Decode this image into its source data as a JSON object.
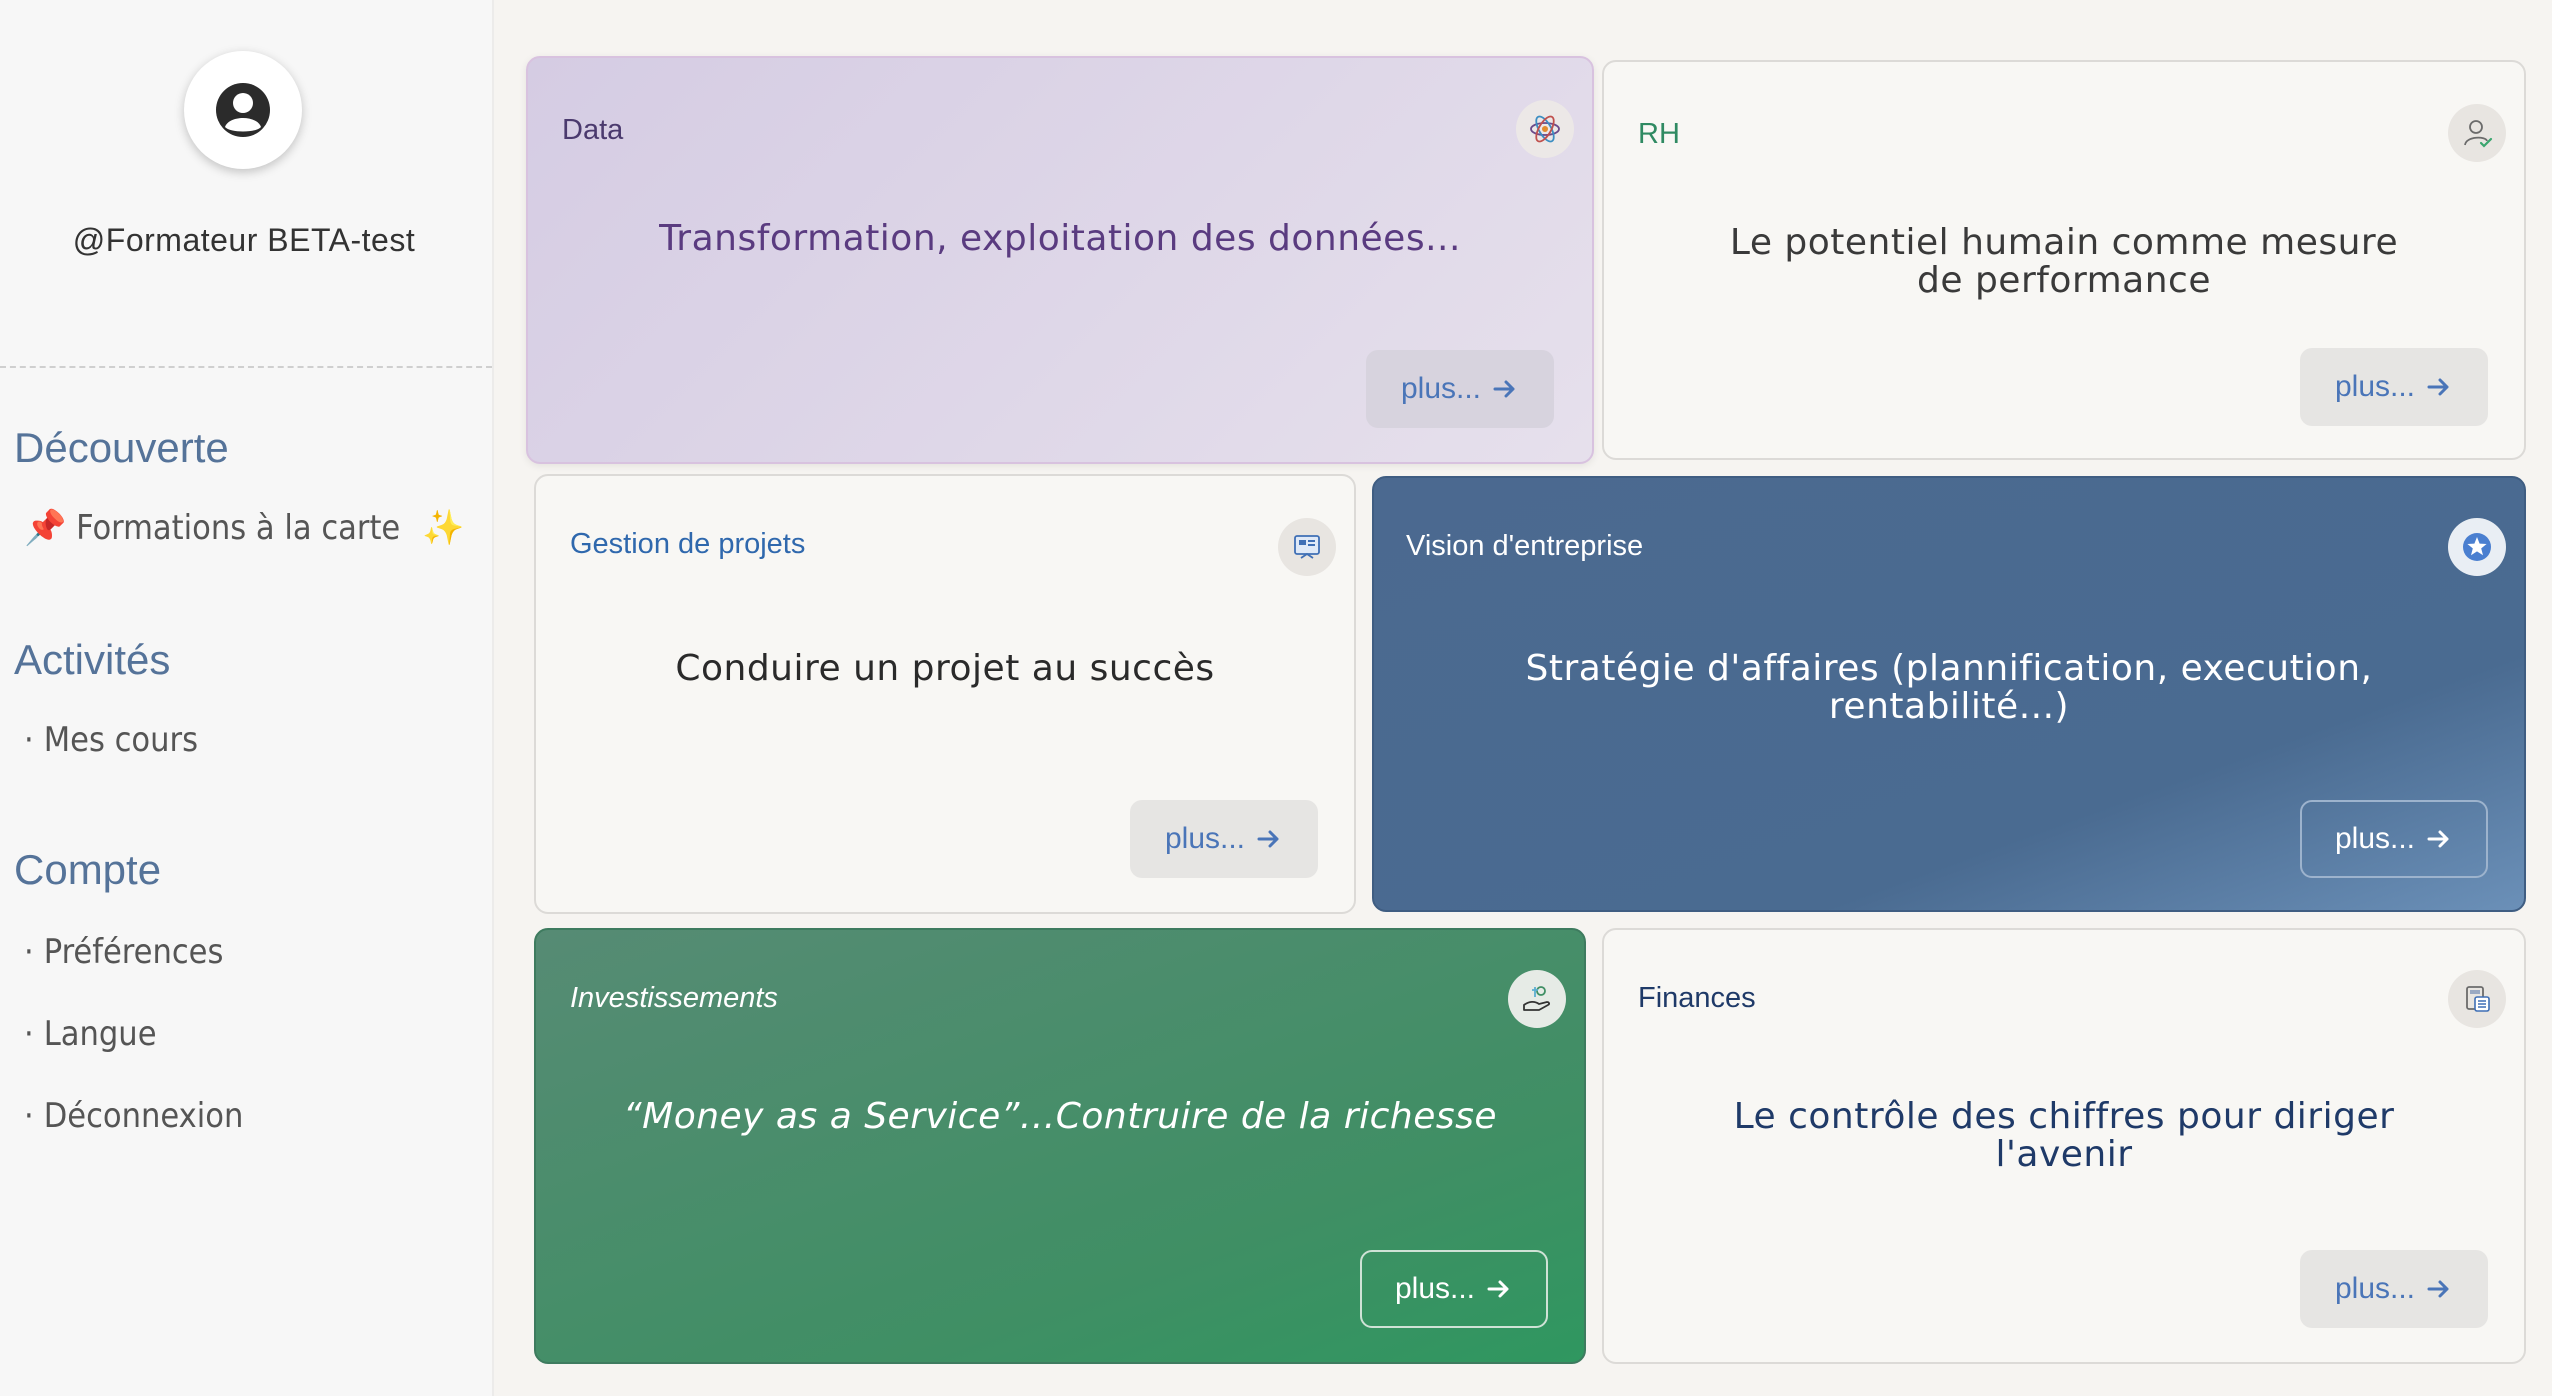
{
  "sidebar": {
    "username": "@Formateur BETA-test",
    "sections": [
      {
        "title": "Découverte",
        "items": [
          {
            "label": "Formations à la carte",
            "emoji_before": "📌",
            "emoji_after": "✨"
          }
        ]
      },
      {
        "title": "Activités",
        "items": [
          {
            "label": "Mes cours"
          }
        ]
      },
      {
        "title": "Compte",
        "items": [
          {
            "label": "Préférences"
          },
          {
            "label": "Langue"
          },
          {
            "label": "Déconnexion"
          }
        ]
      }
    ],
    "bullet": "·"
  },
  "cards": {
    "data": {
      "label": "Data",
      "desc": "Transformation, exploitation des données...",
      "icon": "atom-icon",
      "button": "plus..."
    },
    "rh": {
      "label": "RH",
      "desc": "Le potentiel humain comme mesure de performance",
      "icon": "user-check-icon",
      "button": "plus..."
    },
    "gestion": {
      "label": "Gestion de projets",
      "desc": "Conduire un projet au succès",
      "icon": "project-board-icon",
      "button": "plus..."
    },
    "vision": {
      "label": "Vision d'entreprise",
      "desc": "Stratégie d'affaires (plannification, execution, rentabilité...)",
      "icon": "star-badge-icon",
      "button": "plus..."
    },
    "investissements": {
      "label": "Investissements",
      "desc": "“Money as a Service”...Contruire de la richesse",
      "icon": "hand-money-icon",
      "button": "plus..."
    },
    "finances": {
      "label": "Finances",
      "desc": "Le contrôle des chiffres pour diriger l'avenir",
      "icon": "calculator-icon",
      "button": "plus..."
    }
  },
  "colors": {
    "accent_blue": "#4a75b8",
    "data_purple": "#5a3b80",
    "rh_green": "#2f8a62",
    "vision_blue": "#4b6990",
    "invest_green": "#3f8f64",
    "finance_navy": "#1f3a68"
  }
}
